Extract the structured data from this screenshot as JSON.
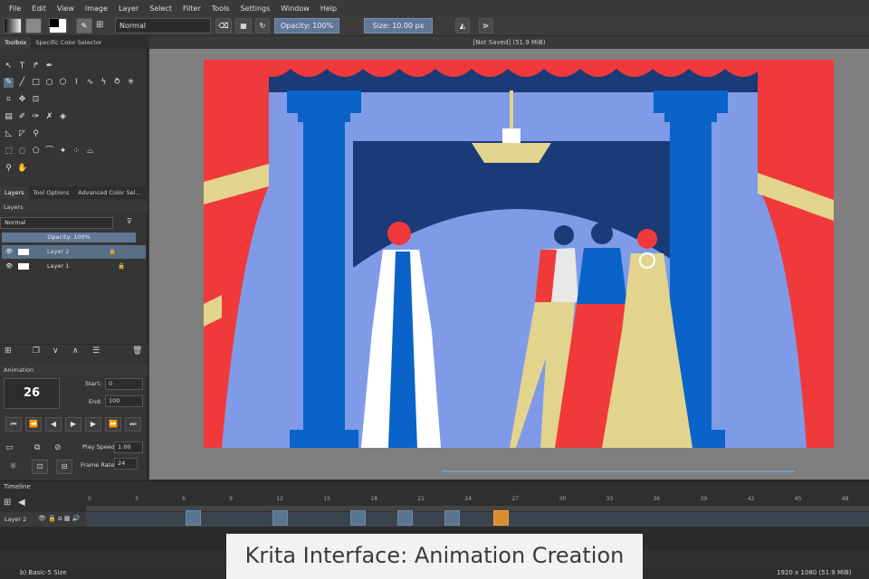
{
  "menu": [
    "File",
    "Edit",
    "View",
    "Image",
    "Layer",
    "Select",
    "Filter",
    "Tools",
    "Settings",
    "Window",
    "Help"
  ],
  "toolbar": {
    "blend_mode": "Normal",
    "opacity": "Opacity: 100%",
    "size": "Size: 10.00 px"
  },
  "left_tabs_top": [
    "Toolbox",
    "Specific Color Selector"
  ],
  "left_tabs_mid": [
    "Layers",
    "Tool Options",
    "Advanced Color Sel..."
  ],
  "layers_panel": {
    "title": "Layers",
    "blend": "Normal",
    "opacity": "Opacity: 100%",
    "layers": [
      {
        "name": "Layer 2",
        "selected": true
      },
      {
        "name": "Layer 1",
        "selected": false
      }
    ]
  },
  "animation": {
    "title": "Animation",
    "current_frame": "26",
    "start_label": "Start:",
    "start": "0",
    "end_label": "End:",
    "end": "100",
    "play_speed_label": "Play Speed:",
    "play_speed": "1.00",
    "frame_rate_label": "Frame Rate:",
    "frame_rate": "24"
  },
  "document_title": "[Not Saved]  (51.9 MiB)",
  "timeline": {
    "title": "Timeline",
    "layer": "Layer 2",
    "ticks": [
      "0",
      "3",
      "6",
      "9",
      "12",
      "15",
      "18",
      "21",
      "24",
      "27",
      "30",
      "33",
      "36",
      "39",
      "42",
      "45",
      "48"
    ],
    "keyframes": [
      9,
      20,
      30,
      36,
      42
    ],
    "current": 36
  },
  "status": {
    "brush": "b) Basic-5 Size",
    "dims": "1920 x 1080 (51.9 MiB)"
  },
  "caption": "Krita Interface: Animation Creation",
  "colors": {
    "curtain": "#f0393a",
    "stage_blue": "#1a3a78",
    "wall": "#7f9be8",
    "column": "#0a63c9",
    "gold": "#e2d48c"
  }
}
